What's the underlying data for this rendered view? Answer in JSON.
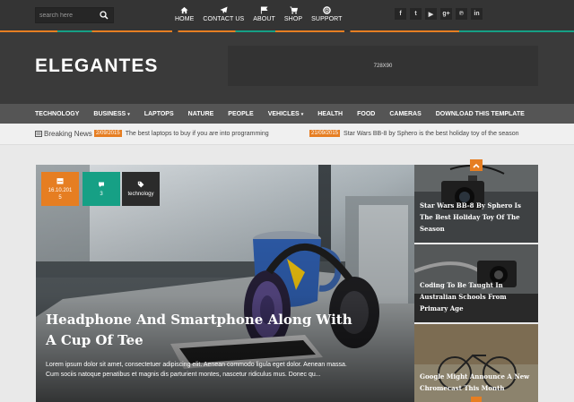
{
  "search": {
    "placeholder": "search here"
  },
  "topnav": [
    {
      "label": "HOME",
      "icon": "home-icon"
    },
    {
      "label": "CONTACT US",
      "icon": "paper-plane-icon"
    },
    {
      "label": "ABOUT",
      "icon": "flag-icon"
    },
    {
      "label": "SHOP",
      "icon": "cart-icon"
    },
    {
      "label": "SUPPORT",
      "icon": "lifebuoy-icon"
    }
  ],
  "social": [
    {
      "glyph": "f",
      "icon": "facebook-icon"
    },
    {
      "glyph": "t",
      "icon": "twitter-icon"
    },
    {
      "glyph": "▶",
      "icon": "youtube-icon"
    },
    {
      "glyph": "g+",
      "icon": "google-plus-icon"
    },
    {
      "glyph": "℗",
      "icon": "pinterest-icon"
    },
    {
      "glyph": "in",
      "icon": "linkedin-icon"
    }
  ],
  "logo": "ELEGANTES",
  "ad": "728X90",
  "mainnav": [
    {
      "label": "TECHNOLOGY",
      "caret": ""
    },
    {
      "label": "BUSINESS",
      "caret": "▾"
    },
    {
      "label": "LAPTOPS",
      "caret": ""
    },
    {
      "label": "NATURE",
      "caret": ""
    },
    {
      "label": "PEOPLE",
      "caret": ""
    },
    {
      "label": "VEHICLES",
      "caret": "▾"
    },
    {
      "label": "HEALTH",
      "caret": ""
    },
    {
      "label": "FOOD",
      "caret": ""
    },
    {
      "label": "CAMERAS",
      "caret": ""
    },
    {
      "label": "DOWNLOAD THIS TEMPLATE",
      "caret": ""
    }
  ],
  "breaking": {
    "label": "Breaking News",
    "items": [
      {
        "date": "2/09/2015",
        "text": "The best laptops to buy if you are into programming"
      },
      {
        "date": "21/09/2015",
        "text": "Star Wars BB-8 by Sphero is the best holiday toy of the season"
      }
    ]
  },
  "featured": {
    "date": "16.10.2015",
    "comments": "3",
    "tag": "technology",
    "title": "Headphone And Smartphone Along With A Cup Of Tee",
    "excerpt": "Lorem ipsum dolor sit amet, consectetuer adipiscing elit. Aenean commodo ligula eget dolor. Aenean massa. Cum sociis natoque penatibus et magnis dis parturient montes, nascetur ridiculus mus. Donec qu..."
  },
  "side": [
    {
      "title": "Star Wars BB-8 By Sphero Is The Best Holiday Toy Of The Season"
    },
    {
      "title": "Coding To Be Taught In Australian Schools From Primary Age"
    },
    {
      "title": "Google Might Announce A New Chromecast This Month"
    }
  ],
  "colors": {
    "accent": "#e67e22",
    "teal": "#16a085",
    "dark": "#343434"
  }
}
